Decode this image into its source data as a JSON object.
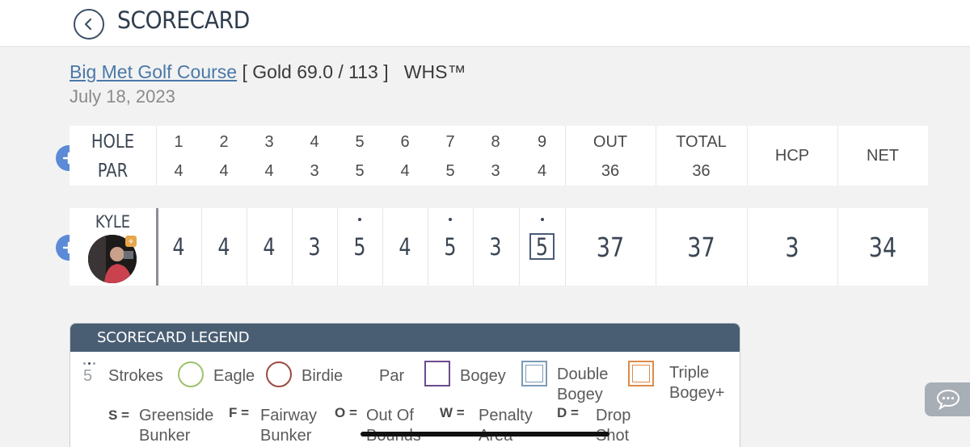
{
  "header": {
    "title": "SCORECARD"
  },
  "course": {
    "name": "Big Met Golf Course",
    "tee_info": "[ Gold 69.0 / 113 ]",
    "system": "WHS™",
    "date": "July 18, 2023"
  },
  "scorecard": {
    "hole_label": "HOLE",
    "par_label": "PAR",
    "holes": [
      "1",
      "2",
      "3",
      "4",
      "5",
      "6",
      "7",
      "8",
      "9"
    ],
    "pars": [
      "4",
      "4",
      "4",
      "3",
      "5",
      "4",
      "5",
      "3",
      "4"
    ],
    "out_label": "OUT",
    "total_label": "TOTAL",
    "hcp_label": "HCP",
    "net_label": "NET",
    "par_out": "36",
    "par_total": "36"
  },
  "player": {
    "name": "KYLE",
    "scores": [
      "4",
      "4",
      "4",
      "3",
      "5",
      "4",
      "5",
      "3",
      "5"
    ],
    "out": "37",
    "total": "37",
    "hcp": "3",
    "net": "34"
  },
  "legend": {
    "title": "SCORECARD LEGEND",
    "strokes_example": "5",
    "strokes": "Strokes",
    "eagle": "Eagle",
    "birdie": "Birdie",
    "par": "Par",
    "bogey": "Bogey",
    "double_bogey_1": "Double",
    "double_bogey_2": "Bogey",
    "triple_bogey_1": "Triple",
    "triple_bogey_2": "Bogey+",
    "s_key": "S =",
    "s_1": "Greenside",
    "s_2": "Bunker",
    "f_key": "F =",
    "f_1": "Fairway",
    "f_2": "Bunker",
    "o_key": "O =",
    "o_1": "Out Of",
    "o_2": "Bounds",
    "w_key": "W =",
    "w_1": "Penalty",
    "w_2": "Area",
    "d_key": "D =",
    "d_1": "Drop",
    "d_2": "Shot",
    "colors": {
      "eagle": "#9cc26a",
      "birdie": "#9b4a40",
      "bogey": "#6c4a8e",
      "double_bogey": "#7c9bb5",
      "triple_bogey": "#e08a4a"
    }
  }
}
